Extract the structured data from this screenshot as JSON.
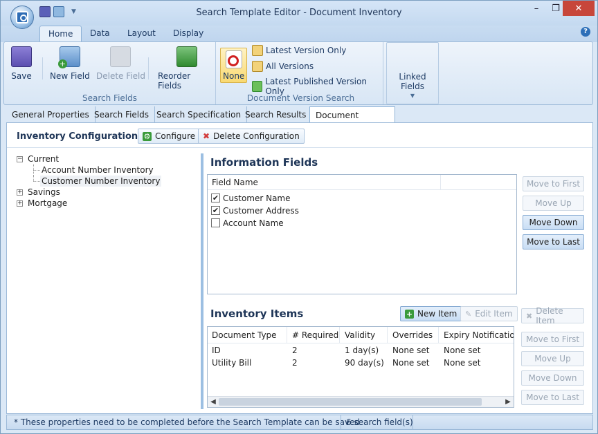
{
  "window": {
    "title": "Search Template Editor - Document Inventory"
  },
  "ribbon": {
    "tabs": [
      {
        "label": "Home"
      },
      {
        "label": "Data"
      },
      {
        "label": "Layout"
      },
      {
        "label": "Display"
      }
    ],
    "search_fields": {
      "label": "Search Fields",
      "save": "Save",
      "new_field": "New Field",
      "delete_field": "Delete Field",
      "reorder_fields": "Reorder Fields"
    },
    "version_search": {
      "label": "Document Version Search",
      "none": "None",
      "latest_only": "Latest Version Only",
      "all_versions": "All Versions",
      "latest_published": "Latest Published Version Only"
    },
    "linked_fields": "Linked Fields"
  },
  "doc_tabs": [
    {
      "label": "General Properties"
    },
    {
      "label": "Search Fields"
    },
    {
      "label": "Search Specification"
    },
    {
      "label": "Search Results"
    },
    {
      "label": "Document Inventory"
    }
  ],
  "config": {
    "title": "Inventory Configuration",
    "configure": "Configure",
    "delete": "Delete Configuration"
  },
  "tree": {
    "current": "Current",
    "children": [
      "Account Number Inventory",
      "Customer Number Inventory"
    ],
    "savings": "Savings",
    "mortgage": "Mortgage"
  },
  "info_fields": {
    "title": "Information Fields",
    "column": "Field Name",
    "rows": [
      {
        "name": "Customer Name",
        "checked": "✔"
      },
      {
        "name": "Customer Address",
        "checked": "✔"
      },
      {
        "name": "Account Name",
        "checked": ""
      }
    ],
    "buttons": {
      "first": "Move to First",
      "up": "Move Up",
      "down": "Move Down",
      "last": "Move to Last"
    }
  },
  "inventory": {
    "title": "Inventory Items",
    "new_item": "New Item",
    "edit_item": "Edit Item",
    "delete_item": "Delete Item",
    "columns": [
      "Document Type",
      "# Required",
      "Validity",
      "Overrides",
      "Expiry Notifications"
    ],
    "rows": [
      [
        "ID",
        "2",
        "1 day(s)",
        "None set",
        "None set"
      ],
      [
        "Utility Bill",
        "2",
        "90 day(s)",
        "None set",
        "None set"
      ]
    ],
    "buttons": {
      "first": "Move to First",
      "up": "Move Up",
      "down": "Move Down",
      "last": "Move to Last"
    }
  },
  "status": {
    "message": "* These properties need to be completed before the Search Template can be saved",
    "count": "6 search field(s)"
  }
}
